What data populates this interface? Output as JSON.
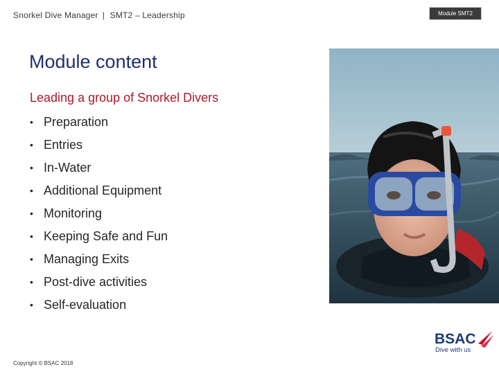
{
  "header": {
    "course": "Snorkel Dive Manager",
    "separator": "|",
    "module": "SMT2 – Leadership"
  },
  "module_tag": "Module SMT2",
  "title": "Module content",
  "subtitle": "Leading a group of Snorkel Divers",
  "bullets": [
    "Preparation",
    "Entries",
    "In-Water",
    "Additional Equipment",
    "Monitoring",
    "Keeping Safe and Fun",
    "Managing Exits",
    "Post-dive activities",
    "Self-evaluation"
  ],
  "bullet_symbol": "•",
  "footer": "Copyright © BSAC 2018",
  "logo": {
    "brand": "BSAC",
    "tagline": "Dive with us",
    "colors": {
      "navy": "#1c3a78",
      "red": "#c8102e"
    }
  },
  "colors": {
    "title": "#1f2f6b",
    "subtitle": "#b0192a",
    "tag_bg": "#3b3b3b"
  },
  "photo": {
    "subject": "snorkeller-in-water"
  }
}
